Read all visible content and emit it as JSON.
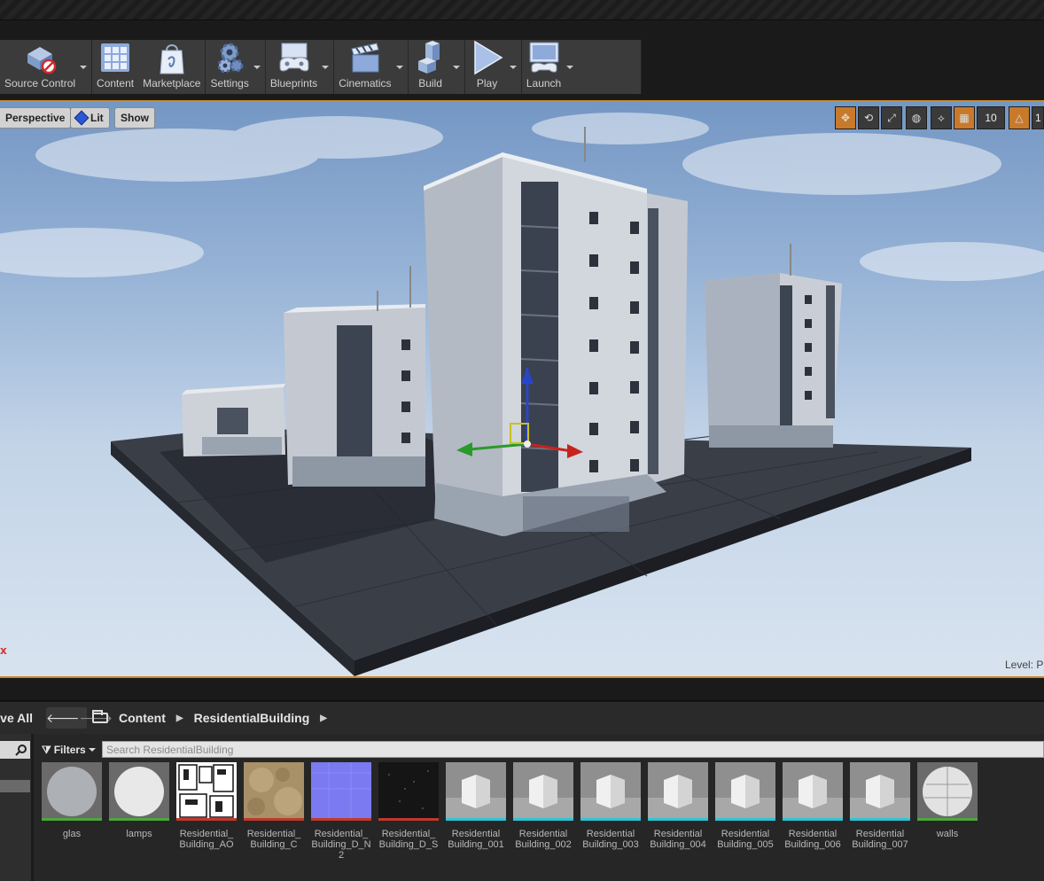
{
  "toolbar": {
    "buttons": [
      {
        "label": "Source Control",
        "icon": "source-control-icon",
        "dropdown": true
      },
      {
        "label": "Content",
        "icon": "content-icon",
        "dropdown": false
      },
      {
        "label": "Marketplace",
        "icon": "marketplace-icon",
        "dropdown": false
      },
      {
        "label": "Settings",
        "icon": "settings-icon",
        "dropdown": true
      },
      {
        "label": "Blueprints",
        "icon": "blueprints-icon",
        "dropdown": true
      },
      {
        "label": "Cinematics",
        "icon": "cinematics-icon",
        "dropdown": true
      },
      {
        "label": "Build",
        "icon": "build-icon",
        "dropdown": true
      },
      {
        "label": "Play",
        "icon": "play-icon",
        "dropdown": true
      },
      {
        "label": "Launch",
        "icon": "launch-icon",
        "dropdown": true
      }
    ]
  },
  "viewport": {
    "perspective_label": "Perspective",
    "lit_label": "Lit",
    "show_label": "Show",
    "grid_snap_value": "10",
    "rotation_snap_value": "1",
    "level_label": "Level:  P",
    "x_marker": "x",
    "accent_color": "#c98a2a"
  },
  "content_browser": {
    "save_all_label": "ve All",
    "breadcrumb": [
      "Content",
      "ResidentialBuilding"
    ],
    "filters_label": "Filters",
    "search_placeholder": "Search ResidentialBuilding",
    "assets": [
      {
        "name": "glas",
        "kind": "material",
        "bar": "#4aa83a"
      },
      {
        "name": "lamps",
        "kind": "material",
        "bar": "#4aa83a"
      },
      {
        "name": "Residential_ Building_AO",
        "kind": "texture",
        "bar": "#c0392b"
      },
      {
        "name": "Residential_ Building_C",
        "kind": "texture",
        "bar": "#c0392b"
      },
      {
        "name": "Residential_ Building_D_N 2",
        "kind": "texture",
        "bar": "#c0392b"
      },
      {
        "name": "Residential_ Building_D_S",
        "kind": "texture",
        "bar": "#c0392b"
      },
      {
        "name": "Residential Building_001",
        "kind": "mesh",
        "bar": "#2fc3d6"
      },
      {
        "name": "Residential Building_002",
        "kind": "mesh",
        "bar": "#2fc3d6"
      },
      {
        "name": "Residential Building_003",
        "kind": "mesh",
        "bar": "#2fc3d6"
      },
      {
        "name": "Residential Building_004",
        "kind": "mesh",
        "bar": "#2fc3d6"
      },
      {
        "name": "Residential Building_005",
        "kind": "mesh",
        "bar": "#2fc3d6"
      },
      {
        "name": "Residential Building_006",
        "kind": "mesh",
        "bar": "#2fc3d6"
      },
      {
        "name": "Residential Building_007",
        "kind": "mesh",
        "bar": "#2fc3d6"
      },
      {
        "name": "walls",
        "kind": "material",
        "bar": "#4aa83a"
      }
    ]
  }
}
